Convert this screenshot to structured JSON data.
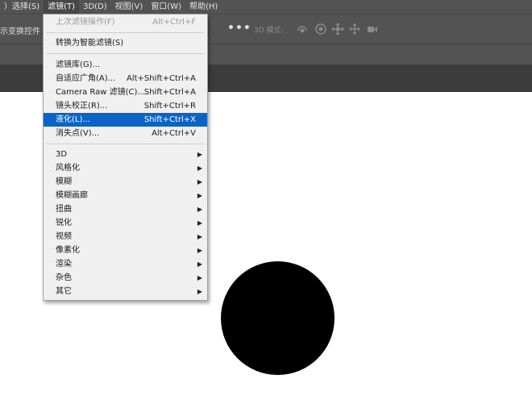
{
  "menubar": {
    "items": [
      "）选择(S)",
      "滤镜(T)",
      "3D(D)",
      "视图(V)",
      "窗口(W)",
      "帮助(H)"
    ]
  },
  "options_bar": {
    "left_label": "示变换控件",
    "more_icon": "ellipsis-icon",
    "mode_3d_label": "3D 模式:",
    "mode_3d_icons": [
      "3d-rotate-icon",
      "3d-roll-icon",
      "3d-pan-icon",
      "3d-slide-icon",
      "3d-scale-icon"
    ]
  },
  "filter_menu": {
    "last_filter": {
      "label": "上次滤镜操作(F)",
      "shortcut": "Alt+Ctrl+F"
    },
    "convert_smart": {
      "label": "转换为智能滤镜(S)"
    },
    "gallery": {
      "label": "滤镜库(G)..."
    },
    "adaptive_wide_angle": {
      "label": "自适应广角(A)...",
      "shortcut": "Alt+Shift+Ctrl+A"
    },
    "camera_raw": {
      "label": "Camera Raw 滤镜(C)...",
      "shortcut": "Shift+Ctrl+A"
    },
    "lens_correction": {
      "label": "镜头校正(R)...",
      "shortcut": "Shift+Ctrl+R"
    },
    "liquify": {
      "label": "液化(L)...",
      "shortcut": "Shift+Ctrl+X"
    },
    "vanishing_point": {
      "label": "消失点(V)...",
      "shortcut": "Alt+Ctrl+V"
    },
    "submenus": [
      "3D",
      "风格化",
      "模糊",
      "模糊画廊",
      "扭曲",
      "锐化",
      "视频",
      "像素化",
      "渲染",
      "杂色",
      "其它"
    ]
  },
  "colors": {
    "highlight": "#0a64c8",
    "menu_bg": "#f0f0f0",
    "app_chrome": "#535353"
  }
}
